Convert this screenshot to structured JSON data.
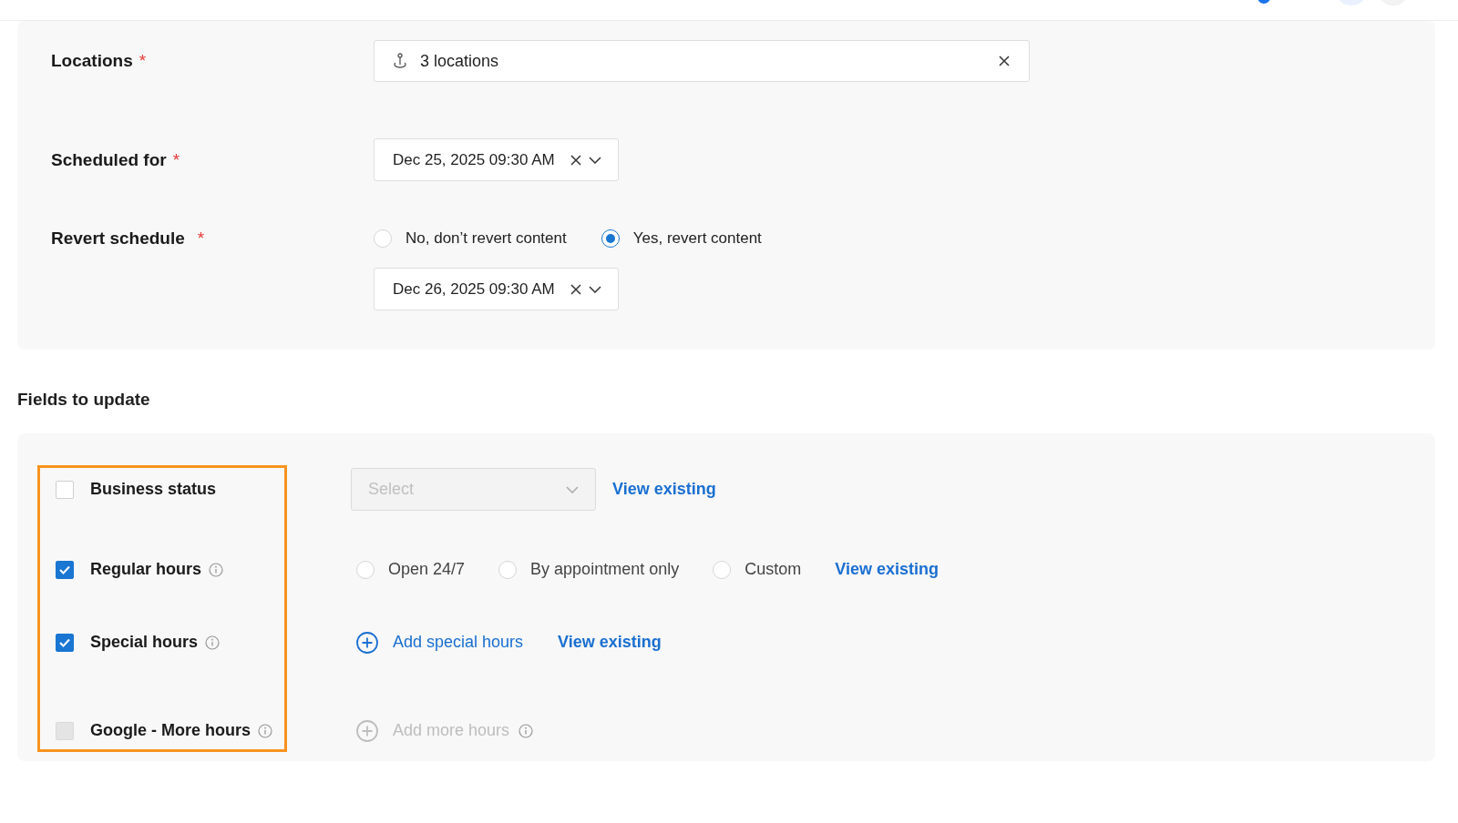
{
  "schedule": {
    "locations": {
      "label": "Locations",
      "required_mark": "*",
      "value": "3 locations"
    },
    "scheduled_for": {
      "label": "Scheduled for",
      "required_mark": "*",
      "value": "Dec 25, 2025 09:30 AM"
    },
    "revert": {
      "label": "Revert schedule",
      "required_mark": "*",
      "options": [
        {
          "label": "No, don’t revert content",
          "selected": false
        },
        {
          "label": "Yes, revert content",
          "selected": true
        }
      ],
      "value": "Dec 26, 2025 09:30 AM"
    }
  },
  "fields_section": {
    "title": "Fields to update",
    "highlighted": true,
    "rows": [
      {
        "label": "Business status",
        "checked": false,
        "disabled": false,
        "kind": "select",
        "select": {
          "placeholder": "Select",
          "disabled": true
        },
        "link": "View existing"
      },
      {
        "label": "Regular hours",
        "checked": true,
        "disabled": false,
        "info": true,
        "kind": "radios",
        "options": [
          {
            "label": "Open 24/7",
            "selected": false
          },
          {
            "label": "By appointment only",
            "selected": false
          },
          {
            "label": "Custom",
            "selected": false
          }
        ],
        "link": "View existing"
      },
      {
        "label": "Special hours",
        "checked": true,
        "disabled": false,
        "info": true,
        "kind": "add",
        "add": {
          "label": "Add special hours",
          "disabled": false
        },
        "link": "View existing"
      },
      {
        "label": "Google - More hours",
        "checked": false,
        "disabled": true,
        "info": true,
        "kind": "add",
        "add": {
          "label": "Add more hours",
          "disabled": true,
          "info": true
        }
      }
    ]
  }
}
